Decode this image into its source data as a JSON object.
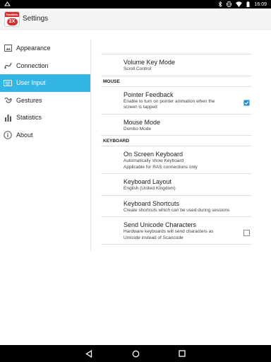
{
  "status_bar": {
    "time": "16:09"
  },
  "action_bar": {
    "title": "Settings",
    "logo_brand": "Parallels",
    "logo_mark": "2X"
  },
  "sidebar": {
    "items": [
      {
        "label": "Appearance",
        "icon": "image-icon",
        "active": false
      },
      {
        "label": "Connection",
        "icon": "connection-icon",
        "active": false
      },
      {
        "label": "User Input",
        "icon": "keyboard-icon",
        "active": true
      },
      {
        "label": "Gestures",
        "icon": "gesture-icon",
        "active": false
      },
      {
        "label": "Statistics",
        "icon": "bar-chart-icon",
        "active": false
      },
      {
        "label": "About",
        "icon": "info-icon",
        "active": false
      }
    ]
  },
  "content": {
    "volume_key_mode": {
      "title": "Volume Key Mode",
      "summary": "Scroll Control"
    },
    "mouse_header": "MOUSE",
    "pointer_feedback": {
      "title": "Pointer Feedback",
      "summary": "Enable to turn on pointer animation when the screen is tapped",
      "checked": true
    },
    "mouse_mode": {
      "title": "Mouse Mode",
      "summary": "Dumbo Mode"
    },
    "keyboard_header": "KEYBOARD",
    "on_screen_keyboard": {
      "title": "On Screen Keyboard",
      "summary_line1": "Automatically show Keyboard",
      "summary_line2": "Applicable for RAS connections only"
    },
    "keyboard_layout": {
      "title": "Keyboard Layout",
      "summary": "English (United Kingdom)"
    },
    "keyboard_shortcuts": {
      "title": "Keyboard Shortcuts",
      "summary": "Create shortcuts which can be used during sessions"
    },
    "send_unicode": {
      "title": "Send Unicode Characters",
      "summary": "Hardware keyboards will send characters as Unicode instead of Scancode",
      "checked": false
    }
  },
  "colors": {
    "accent": "#33b5e5",
    "check": "#1a8fc9",
    "brand_red": "#d32f2f"
  }
}
